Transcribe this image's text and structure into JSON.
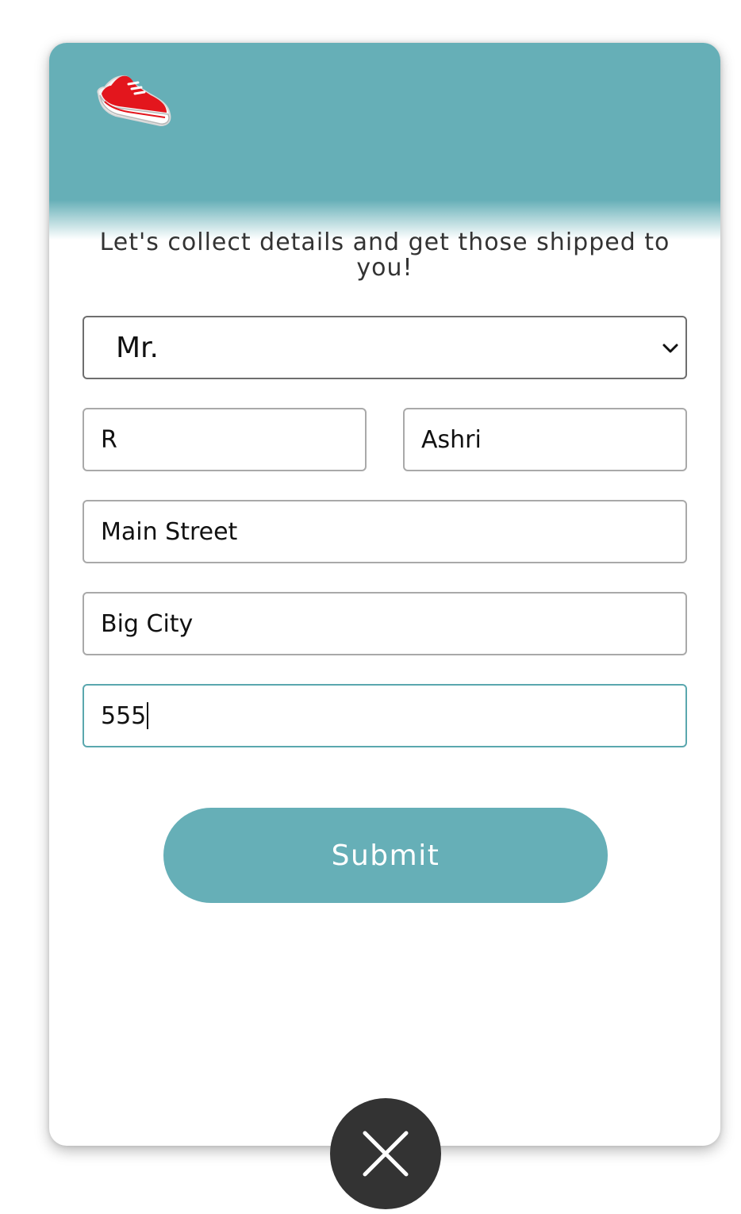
{
  "header": {
    "logo_icon": "running-shoe-icon",
    "background_color": "#66afb7"
  },
  "form": {
    "intro_text": "Let's collect details and get those shipped to you!",
    "title_select": {
      "selected": "Mr."
    },
    "first_name": {
      "value": "R"
    },
    "last_name": {
      "value": "Ashri"
    },
    "street": {
      "value": "Main Street"
    },
    "city": {
      "value": "Big City"
    },
    "zip": {
      "value": "555"
    },
    "submit_label": "Submit",
    "accent_color": "#66afb7"
  },
  "overlay": {
    "close_icon": "close-icon",
    "close_background": "#333333"
  }
}
